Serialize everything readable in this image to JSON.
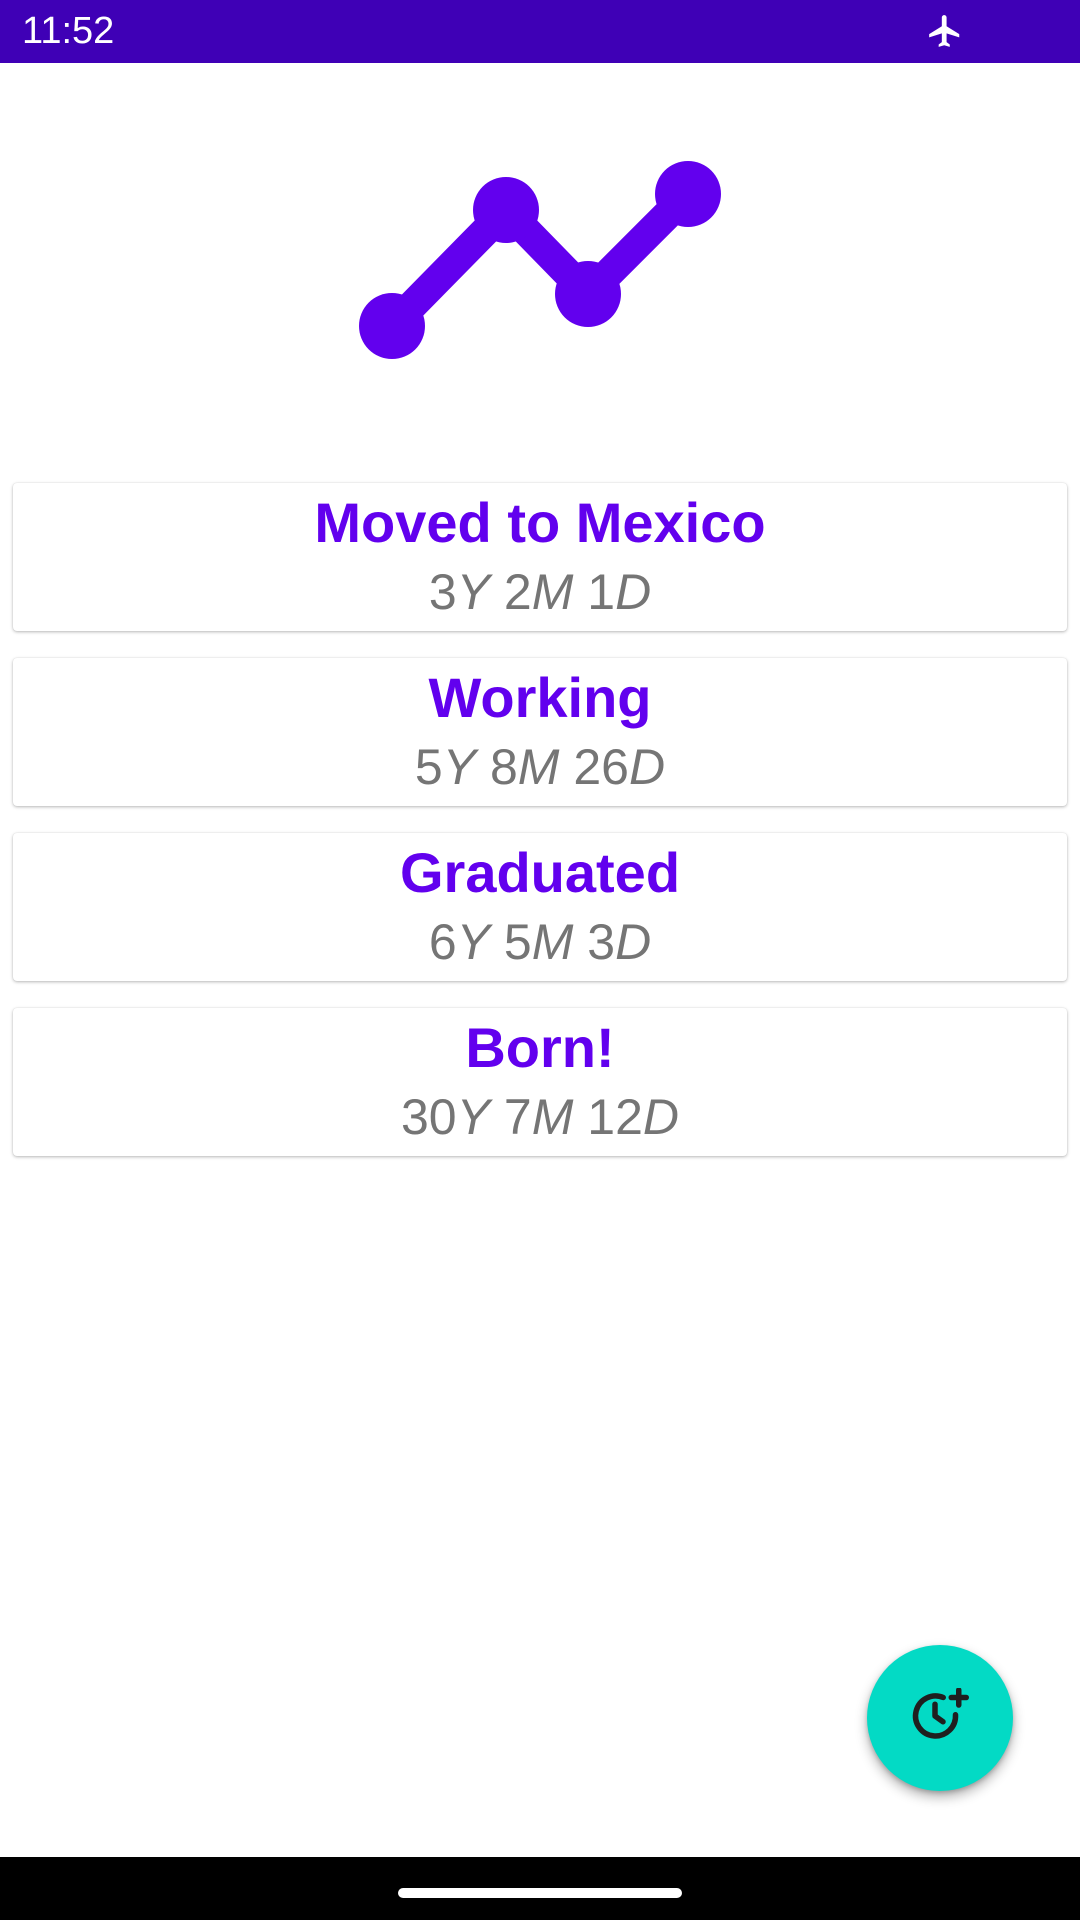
{
  "status_bar": {
    "time": "11:52",
    "background": "#3f00b6",
    "icons": [
      "airplane-mode-icon"
    ]
  },
  "header": {
    "logo_icon": "timeline-chart-icon",
    "accent_color": "#6200ee"
  },
  "events": [
    {
      "title": "Moved to Mexico",
      "years": "3",
      "months": "2",
      "days": "1"
    },
    {
      "title": "Working",
      "years": "5",
      "months": "8",
      "days": "26"
    },
    {
      "title": "Graduated",
      "years": "6",
      "months": "5",
      "days": "3"
    },
    {
      "title": "Born!",
      "years": "30",
      "months": "7",
      "days": "12"
    }
  ],
  "units": {
    "years": "Y",
    "months": "M",
    "days": "D"
  },
  "fab": {
    "icon": "add-clock-icon",
    "color": "#03dac5"
  }
}
